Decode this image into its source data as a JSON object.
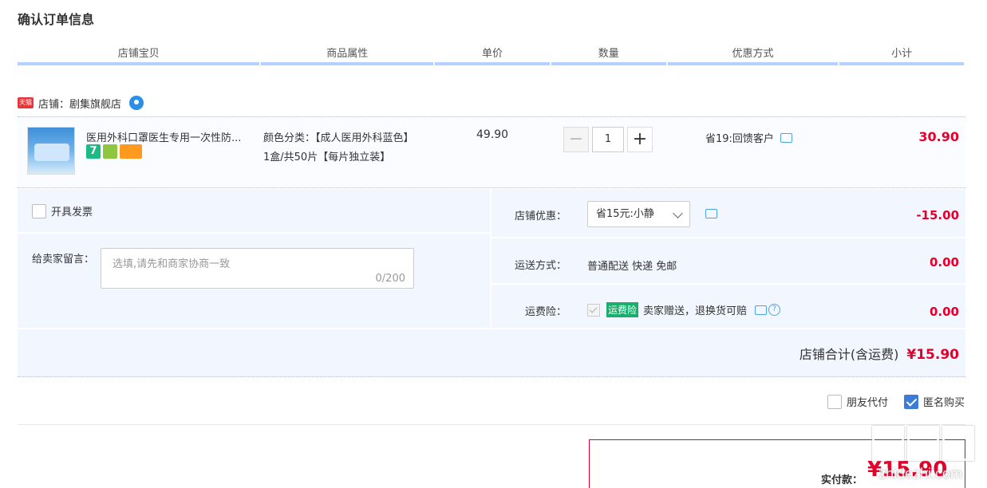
{
  "page": {
    "title": "确认订单信息"
  },
  "columns": [
    "店铺宝贝",
    "商品属性",
    "单价",
    "数量",
    "优惠方式",
    "小计"
  ],
  "shop": {
    "badge": "天猫",
    "label": "店铺：剧集旗舰店"
  },
  "item": {
    "title": "医用外科口罩医生专用一次性防...",
    "tag7": "7",
    "attr_color": "颜色分类：【成人医用外科蓝色】",
    "attr_pack": "1盒/共50片【每片独立装】",
    "unit_price": "49.90",
    "quantity": "1",
    "minus": "−",
    "plus": "+",
    "promo": "省19:回馈客户",
    "subtotal": "30.90"
  },
  "invoice": {
    "label": "开具发票"
  },
  "message": {
    "label": "给卖家留言：",
    "placeholder": "选填,请先和商家协商一致",
    "count": "0/200"
  },
  "shop_discount": {
    "label": "店铺优惠：",
    "selected": "省15元:小静",
    "amount": "-15.00"
  },
  "shipping": {
    "label": "运送方式：",
    "method": "普通配送 快递 免邮",
    "amount": "0.00"
  },
  "insurance": {
    "label": "运费险：",
    "badge": "运费险",
    "text": "卖家赠送，退换货可赔",
    "amount": "0.00",
    "q": "?"
  },
  "shop_total": {
    "label": "店铺合计(含运费)",
    "amount": "¥15.90"
  },
  "options": {
    "friend_pay": "朋友代付",
    "anonymous": "匿名购买"
  },
  "payment": {
    "label": "实付款：",
    "amount": "¥15.90"
  },
  "watermark": {
    "text": "zhidezhi.com"
  },
  "colors": {
    "accent": "#e4002b",
    "header_line": "#b2d1ff",
    "panel": "#f2f7ff",
    "check_blue": "#3d7bd6"
  }
}
